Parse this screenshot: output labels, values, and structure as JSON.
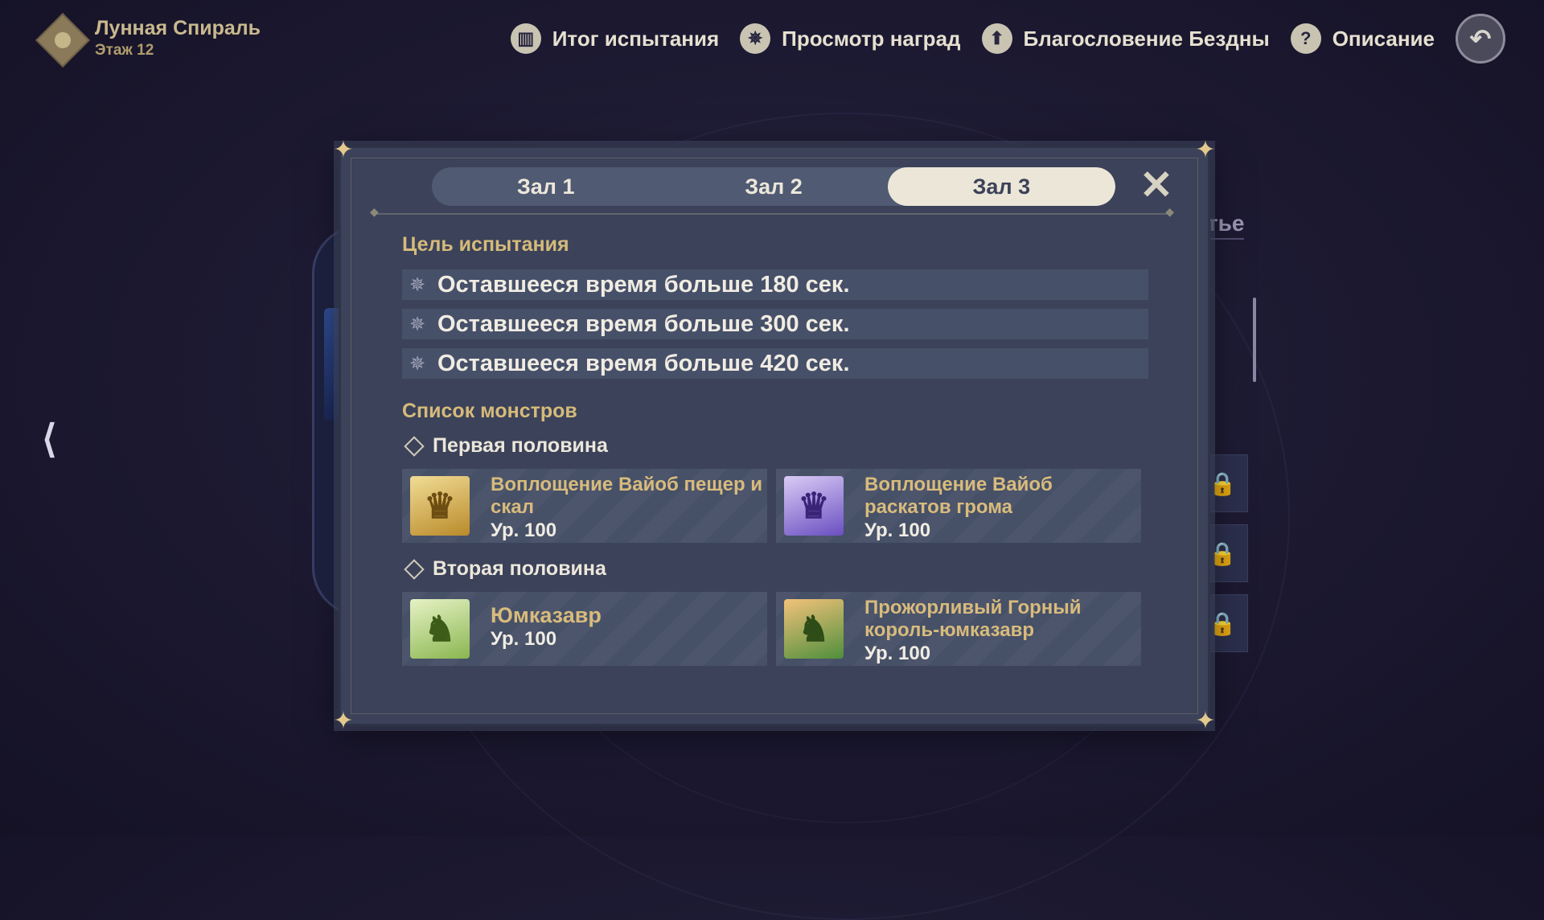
{
  "header": {
    "title": "Лунная Спираль",
    "subtitle": "Этаж 12"
  },
  "topnav": [
    {
      "label": "Итог испытания",
      "icon": "book-icon"
    },
    {
      "label": "Просмотр наград",
      "icon": "star-icon"
    },
    {
      "label": "Благословение Бездны",
      "icon": "up-arrow-icon"
    },
    {
      "label": "Описание",
      "icon": "question-icon"
    }
  ],
  "background": {
    "partial_text": "утье"
  },
  "modal": {
    "tabs": [
      "Зал 1",
      "Зал 2",
      "Зал 3"
    ],
    "active_tab": 2,
    "goal_title": "Цель испытания",
    "goals": [
      "Оставшееся время больше 180 сек.",
      "Оставшееся время больше 300 сек.",
      "Оставшееся время больше 420 сек."
    ],
    "monster_title": "Список монстров",
    "halves": [
      {
        "title": "Первая половина",
        "monsters": [
          {
            "name": "Воплощение Вайоб пещер и скал",
            "level": "Ур. 100",
            "color": "#c89a3a"
          },
          {
            "name": "Воплощение Вайоб раскатов грома",
            "level": "Ур. 100",
            "color": "#7b64c9"
          }
        ]
      },
      {
        "title": "Вторая половина",
        "monsters": [
          {
            "name": "Юмказавр",
            "level": "Ур. 100",
            "color": "#8fbd5a"
          },
          {
            "name": "Прожорливый Горный король-юмказавр",
            "level": "Ур. 100",
            "color": "#d98a3a"
          }
        ]
      }
    ]
  },
  "colors": {
    "accent_gold": "#d5ba7a",
    "modal_bg": "#3b4259",
    "tab_active": "#ece6d8"
  }
}
